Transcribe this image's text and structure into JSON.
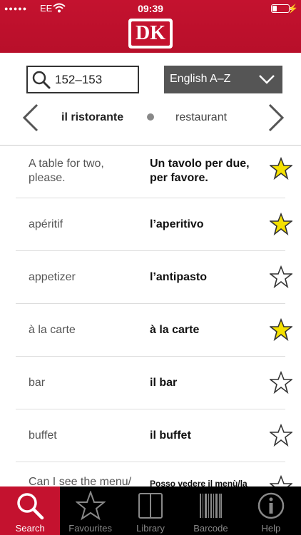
{
  "status_bar": {
    "signal": "●●●●●",
    "carrier": "EE",
    "time": "09:39",
    "battery_level": 0.3
  },
  "header": {
    "logo_text": "DK",
    "brand_color": "#c4122f"
  },
  "search": {
    "value": "152–153",
    "icon": "search-icon"
  },
  "language_select": {
    "selected": "English A–Z"
  },
  "chapter_nav": {
    "current": "il ristorante",
    "translation": "restaurant"
  },
  "phrases": [
    {
      "en": "A table for two, please.",
      "it": "Un tavolo per due, per favore.",
      "favourite": true
    },
    {
      "en": "apéritif",
      "it": "l’aperitivo",
      "favourite": true
    },
    {
      "en": "appetizer",
      "it": "l’antipasto",
      "favourite": false
    },
    {
      "en": "à la carte",
      "it": "à la carte",
      "favourite": true
    },
    {
      "en": "bar",
      "it": "il bar",
      "favourite": false
    },
    {
      "en": "buffet",
      "it": "il buffet",
      "favourite": false
    },
    {
      "en": "Can I see the menu/",
      "it": "Posso vedere il menù/la",
      "favourite": false
    }
  ],
  "tabs": [
    {
      "label": "Search",
      "icon": "search-icon",
      "active": true
    },
    {
      "label": "Favourites",
      "icon": "star-icon",
      "active": false
    },
    {
      "label": "Library",
      "icon": "book-icon",
      "active": false
    },
    {
      "label": "Barcode",
      "icon": "barcode-icon",
      "active": false
    },
    {
      "label": "Help",
      "icon": "info-icon",
      "active": false
    }
  ],
  "colors": {
    "star_filled": "#f5e100",
    "dropdown_bg": "#555555"
  }
}
